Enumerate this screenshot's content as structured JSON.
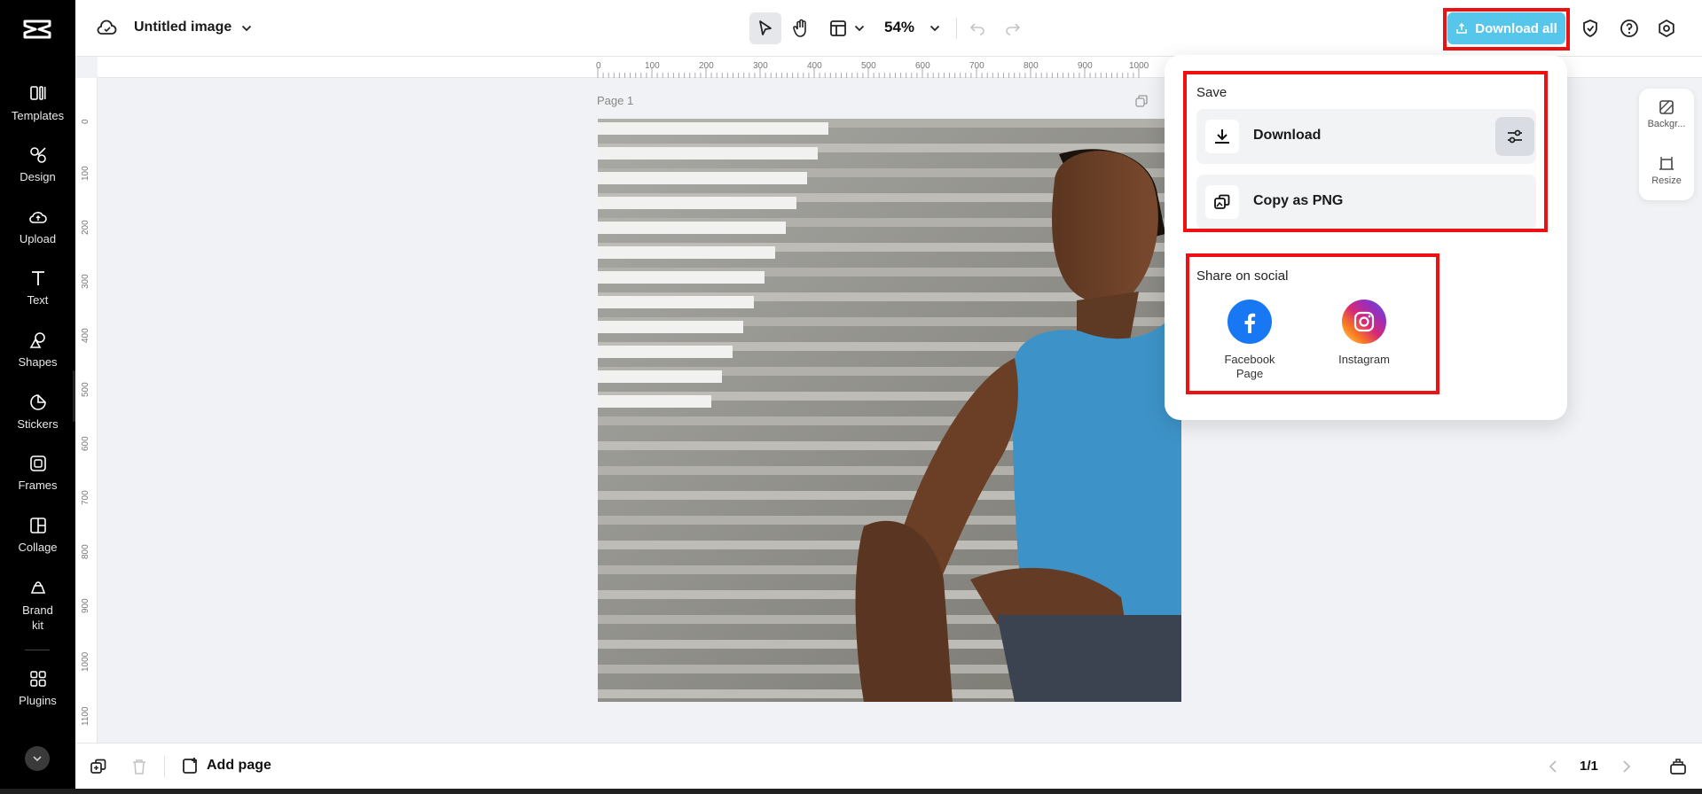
{
  "document": {
    "title": "Untitled image"
  },
  "sidebar": {
    "items": [
      {
        "label": "Templates",
        "icon": "templates-icon"
      },
      {
        "label": "Design",
        "icon": "design-icon"
      },
      {
        "label": "Upload",
        "icon": "upload-cloud-icon"
      },
      {
        "label": "Text",
        "icon": "text-icon"
      },
      {
        "label": "Shapes",
        "icon": "shapes-icon"
      },
      {
        "label": "Stickers",
        "icon": "stickers-icon"
      },
      {
        "label": "Frames",
        "icon": "frames-icon"
      },
      {
        "label": "Collage",
        "icon": "collage-icon"
      },
      {
        "label": "Brand kit",
        "icon": "brand-kit-icon"
      },
      {
        "label": "Plugins",
        "icon": "plugins-icon"
      }
    ]
  },
  "toolbar": {
    "zoom": "54%",
    "download_all_label": "Download all"
  },
  "ruler": {
    "top_ticks": [
      "0",
      "100",
      "200",
      "300",
      "400",
      "500",
      "600",
      "700",
      "800",
      "900",
      "1000"
    ],
    "left_ticks": [
      "0",
      "100",
      "200",
      "300",
      "400",
      "500",
      "600",
      "700",
      "800",
      "900",
      "1000",
      "1100"
    ]
  },
  "canvas": {
    "page_label": "Page 1"
  },
  "download_popup": {
    "save_title": "Save",
    "download_label": "Download",
    "copy_label": "Copy as PNG",
    "share_title": "Share on social",
    "social": [
      {
        "label": "Facebook Page",
        "color": "#1877f2"
      },
      {
        "label": "Instagram",
        "color": "#d62976"
      }
    ]
  },
  "right_panel": {
    "items": [
      {
        "label": "Backgr..."
      },
      {
        "label": "Resize"
      }
    ]
  },
  "bottombar": {
    "add_page_label": "Add page",
    "page_count": "1/1"
  },
  "colors": {
    "accent": "#56c7ea",
    "highlight": "#ee1111",
    "sidebar_bg": "#000000"
  }
}
